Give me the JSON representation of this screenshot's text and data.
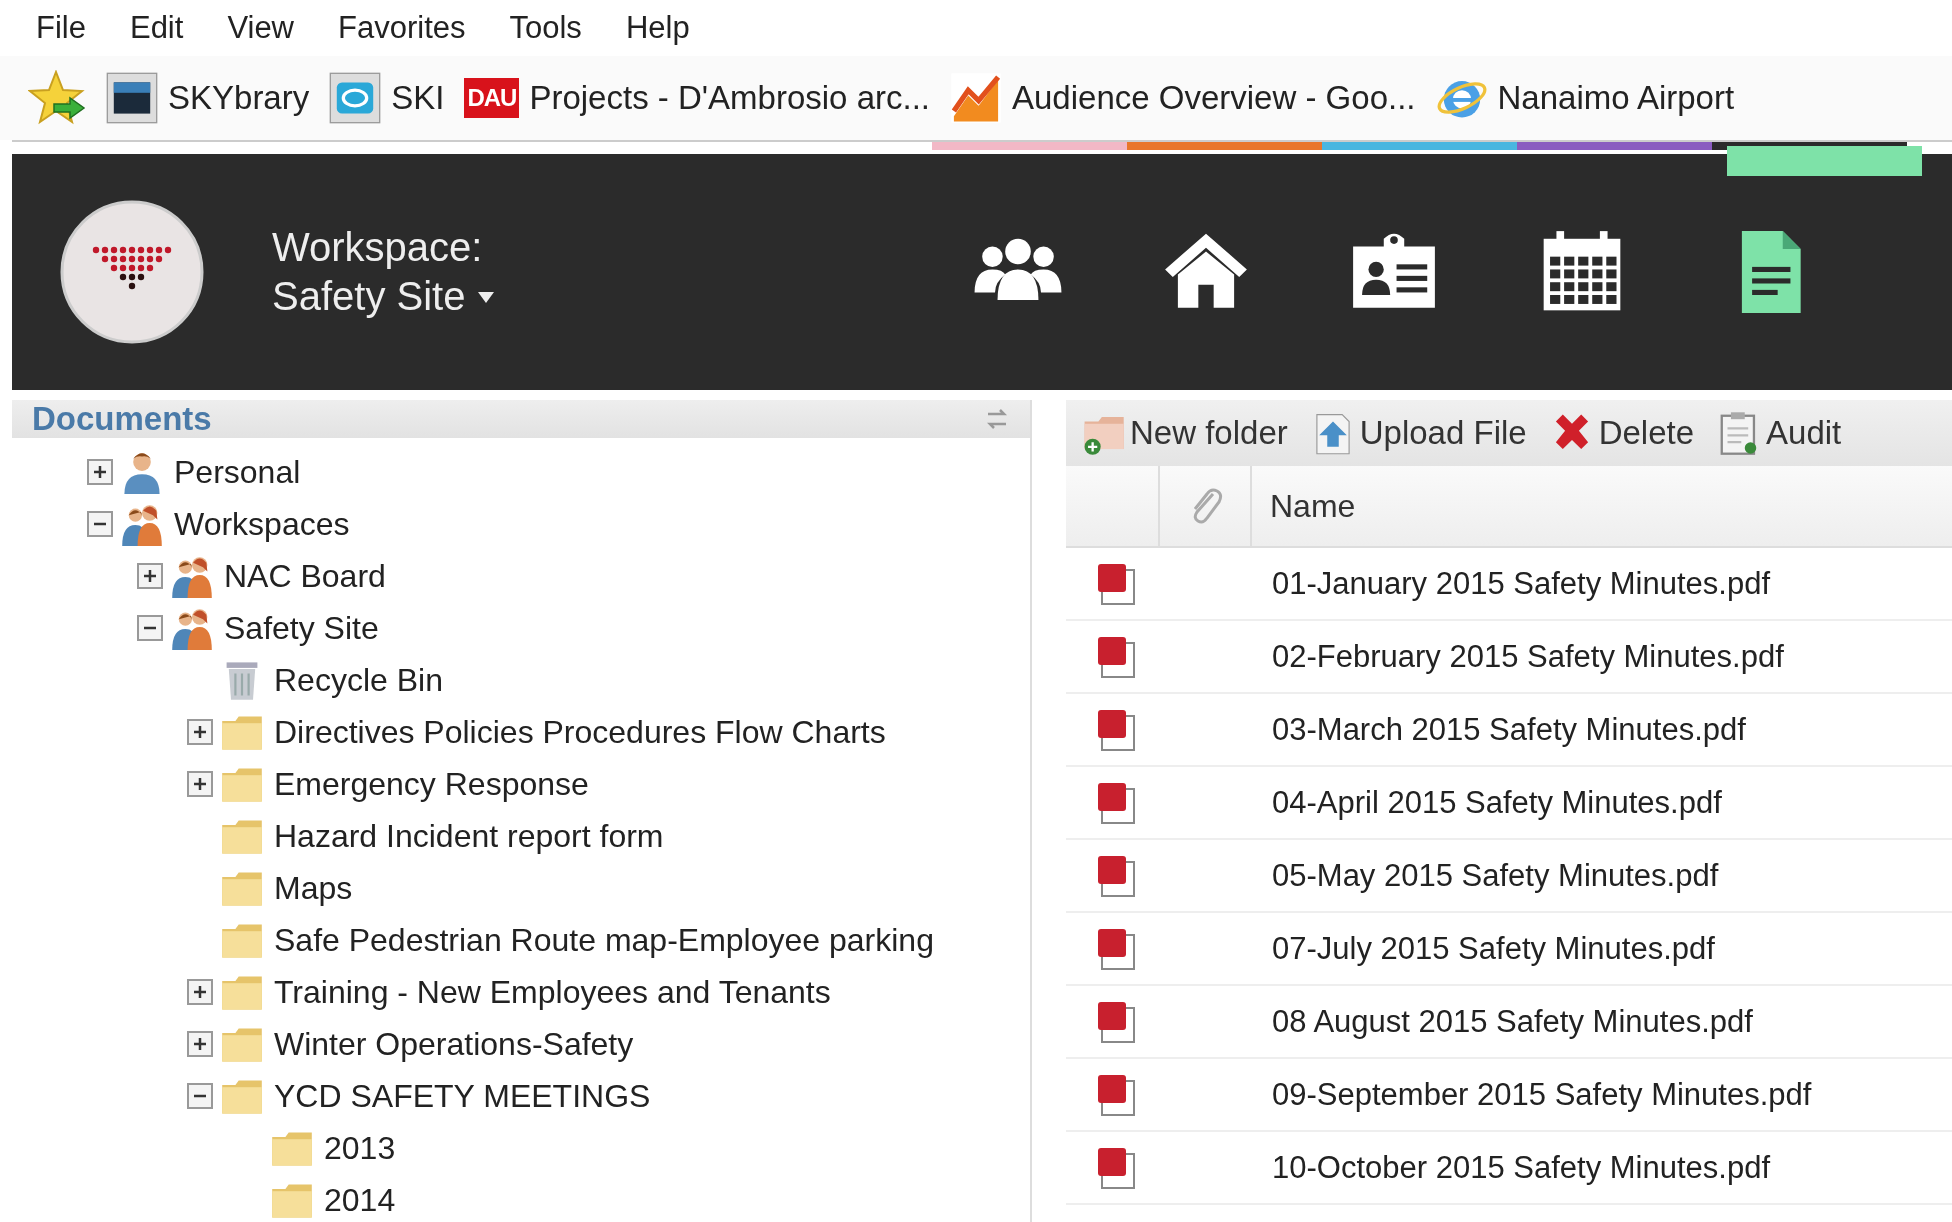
{
  "menu_bar": [
    "File",
    "Edit",
    "View",
    "Favorites",
    "Tools",
    "Help"
  ],
  "bookmarks": [
    {
      "kind": "sky",
      "label": "SKYbrary"
    },
    {
      "kind": "ski",
      "label": "SKI"
    },
    {
      "kind": "dau",
      "icon_text": "DAU",
      "label": "Projects - D'Ambrosio arc..."
    },
    {
      "kind": "chart",
      "label": "Audience Overview - Goo..."
    },
    {
      "kind": "ie",
      "label": "Nanaimo Airport"
    }
  ],
  "header": {
    "workspace_label": "Workspace:",
    "workspace_name": "Safety Site",
    "nav": [
      {
        "kind": "people",
        "selected": false
      },
      {
        "kind": "home",
        "selected": false
      },
      {
        "kind": "card",
        "selected": false
      },
      {
        "kind": "calendar",
        "selected": false
      },
      {
        "kind": "document",
        "selected": true
      }
    ]
  },
  "documents_panel": {
    "title": "Documents",
    "tree": [
      {
        "kind": "person",
        "label": "Personal",
        "expanded": false
      },
      {
        "kind": "group",
        "label": "Workspaces",
        "expanded": true,
        "children": [
          {
            "kind": "group",
            "label": "NAC Board",
            "expanded": false
          },
          {
            "kind": "group",
            "label": "Safety Site",
            "expanded": true,
            "children": [
              {
                "kind": "trash",
                "label": "Recycle Bin"
              },
              {
                "kind": "folder",
                "label": "Directives Policies Procedures Flow Charts",
                "expanded": false
              },
              {
                "kind": "folder",
                "label": "Emergency Response",
                "expanded": false
              },
              {
                "kind": "folder",
                "label": "Hazard Incident report form"
              },
              {
                "kind": "folder",
                "label": "Maps"
              },
              {
                "kind": "folder",
                "label": "Safe Pedestrian Route map-Employee parking"
              },
              {
                "kind": "folder",
                "label": "Training - New Employees and Tenants",
                "expanded": false
              },
              {
                "kind": "folder",
                "label": "Winter Operations-Safety",
                "expanded": false
              },
              {
                "kind": "folder",
                "label": "YCD SAFETY MEETINGS",
                "expanded": true,
                "children": [
                  {
                    "kind": "folder",
                    "label": "2013"
                  },
                  {
                    "kind": "folder",
                    "label": "2014"
                  }
                ]
              }
            ]
          }
        ]
      }
    ]
  },
  "files_panel": {
    "toolbar": [
      {
        "kind": "new-folder",
        "label": "New folder"
      },
      {
        "kind": "upload",
        "label": "Upload File"
      },
      {
        "kind": "delete",
        "label": "Delete"
      },
      {
        "kind": "audit",
        "label": "Audit"
      }
    ],
    "columns": [
      "Name"
    ],
    "rows": [
      "01-January 2015 Safety Minutes.pdf",
      "02-February 2015 Safety Minutes.pdf",
      "03-March 2015 Safety Minutes.pdf",
      "04-April 2015 Safety Minutes.pdf",
      "05-May 2015 Safety Minutes.pdf",
      "07-July 2015 Safety Minutes.pdf",
      "08 August 2015 Safety Minutes.pdf",
      "09-September 2015 Safety Minutes.pdf",
      "10-October 2015 Safety Minutes.pdf"
    ]
  }
}
